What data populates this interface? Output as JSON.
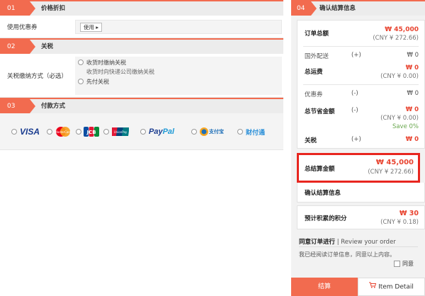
{
  "left": {
    "sec1": {
      "num": "01",
      "title": "价格折扣"
    },
    "coupon": {
      "label": "使用优惠券",
      "button": "使用 ▸"
    },
    "sec2": {
      "num": "02",
      "title": "关税"
    },
    "tax": {
      "label": "关税缴纳方式（必选）",
      "opt1": "收货时缴纳关税",
      "opt1_sub": "收货时向快递公司缴纳关税",
      "opt2": "先付关税"
    },
    "sec3": {
      "num": "03",
      "title": "付款方式"
    },
    "payments": [
      "VISA",
      "MasterCard",
      "JCB",
      "UnionPay",
      "PayPal",
      "支付宝 Alipay",
      "财付通"
    ],
    "visa_text": "VISA",
    "mc_text": "MasterCard",
    "jcb_text": "JCB",
    "up_text": "UnionPay",
    "paypal_text_1": "Pay",
    "paypal_text_2": "Pal",
    "alipay_text": "支付宝",
    "tenpay_text": "财付通"
  },
  "right": {
    "sec4": {
      "num": "04",
      "title": "确认结算信息"
    },
    "order_total": {
      "label": "订单总额",
      "value": "₩ 45,000",
      "cny": "(CNY ¥ 272.66)"
    },
    "intl_shipping": {
      "label": "国外配送",
      "sign": "(+)",
      "value": "₩ 0"
    },
    "shipping_total": {
      "label": "总运费",
      "value": "₩ 0",
      "cny": "(CNY ¥ 0.00)"
    },
    "coupon": {
      "label": "优惠券",
      "sign": "(-)",
      "value": "₩ 0"
    },
    "savings": {
      "label": "总节省金额",
      "sign": "(-)",
      "value": "₩ 0",
      "cny": "(CNY ¥ 0.00)",
      "pct": "Save 0%"
    },
    "tax": {
      "label": "关税",
      "sign": "(+)",
      "value": "₩ 0"
    },
    "grand_total": {
      "label": "总结算金额",
      "value": "₩ 45,000",
      "cny": "(CNY ¥ 272.66)"
    },
    "confirm": "确认结算信息",
    "points": {
      "label": "预计积累的积分",
      "value": "₩ 30",
      "cny": "(CNY ¥ 0.18)"
    },
    "agree_head": "同意订单进行",
    "agree_head_en": "| Review your order",
    "agree_text": "我已经阅读订单信息，同意以上内容。",
    "agree_check": "同意",
    "btn_pay": "结算",
    "btn_detail": "Item Detail"
  },
  "colors": {
    "accent": "#f26b4f",
    "price_red": "#e8432f",
    "highlight_border": "#e8261f"
  }
}
